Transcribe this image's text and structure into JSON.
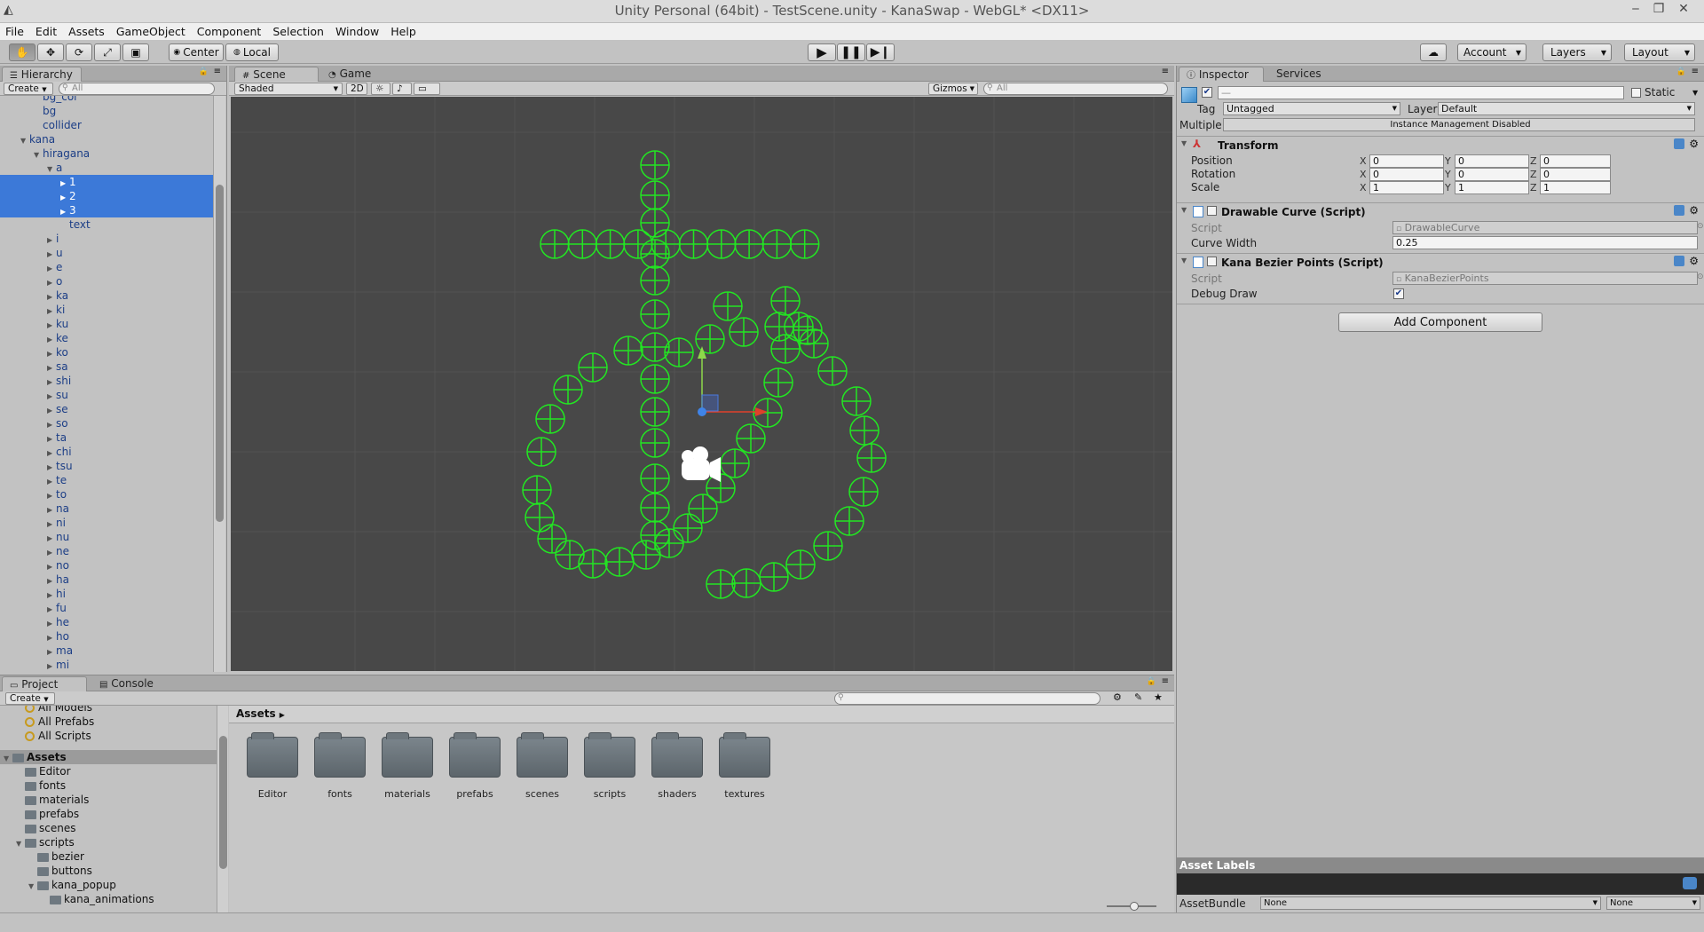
{
  "window": {
    "title": "Unity Personal (64bit) - TestScene.unity - KanaSwap - WebGL* <DX11>"
  },
  "menu": [
    "File",
    "Edit",
    "Assets",
    "GameObject",
    "Component",
    "Selection",
    "Window",
    "Help"
  ],
  "toolbar": {
    "center_label": "Center",
    "local_label": "Local",
    "account_label": "Account",
    "layers_label": "Layers",
    "layout_label": "Layout"
  },
  "hierarchy": {
    "tab_label": "Hierarchy",
    "create_label": "Create",
    "search_placeholder": "All",
    "items": [
      {
        "label": "bg_col",
        "indent": 2,
        "arrow": "",
        "selected": false
      },
      {
        "label": "bg",
        "indent": 2,
        "arrow": "",
        "selected": false
      },
      {
        "label": "collider",
        "indent": 2,
        "arrow": "",
        "selected": false
      },
      {
        "label": "kana",
        "indent": 1,
        "arrow": "open",
        "selected": false
      },
      {
        "label": "hiragana",
        "indent": 2,
        "arrow": "open",
        "selected": false
      },
      {
        "label": "a",
        "indent": 3,
        "arrow": "open",
        "selected": false
      },
      {
        "label": "1",
        "indent": 4,
        "arrow": "closed",
        "selected": true
      },
      {
        "label": "2",
        "indent": 4,
        "arrow": "closed",
        "selected": true
      },
      {
        "label": "3",
        "indent": 4,
        "arrow": "closed",
        "selected": true
      },
      {
        "label": "text",
        "indent": 4,
        "arrow": "",
        "selected": false
      },
      {
        "label": "i",
        "indent": 3,
        "arrow": "closed",
        "selected": false
      },
      {
        "label": "u",
        "indent": 3,
        "arrow": "closed",
        "selected": false
      },
      {
        "label": "e",
        "indent": 3,
        "arrow": "closed",
        "selected": false
      },
      {
        "label": "o",
        "indent": 3,
        "arrow": "closed",
        "selected": false
      },
      {
        "label": "ka",
        "indent": 3,
        "arrow": "closed",
        "selected": false
      },
      {
        "label": "ki",
        "indent": 3,
        "arrow": "closed",
        "selected": false
      },
      {
        "label": "ku",
        "indent": 3,
        "arrow": "closed",
        "selected": false
      },
      {
        "label": "ke",
        "indent": 3,
        "arrow": "closed",
        "selected": false
      },
      {
        "label": "ko",
        "indent": 3,
        "arrow": "closed",
        "selected": false
      },
      {
        "label": "sa",
        "indent": 3,
        "arrow": "closed",
        "selected": false
      },
      {
        "label": "shi",
        "indent": 3,
        "arrow": "closed",
        "selected": false
      },
      {
        "label": "su",
        "indent": 3,
        "arrow": "closed",
        "selected": false
      },
      {
        "label": "se",
        "indent": 3,
        "arrow": "closed",
        "selected": false
      },
      {
        "label": "so",
        "indent": 3,
        "arrow": "closed",
        "selected": false
      },
      {
        "label": "ta",
        "indent": 3,
        "arrow": "closed",
        "selected": false
      },
      {
        "label": "chi",
        "indent": 3,
        "arrow": "closed",
        "selected": false
      },
      {
        "label": "tsu",
        "indent": 3,
        "arrow": "closed",
        "selected": false
      },
      {
        "label": "te",
        "indent": 3,
        "arrow": "closed",
        "selected": false
      },
      {
        "label": "to",
        "indent": 3,
        "arrow": "closed",
        "selected": false
      },
      {
        "label": "na",
        "indent": 3,
        "arrow": "closed",
        "selected": false
      },
      {
        "label": "ni",
        "indent": 3,
        "arrow": "closed",
        "selected": false
      },
      {
        "label": "nu",
        "indent": 3,
        "arrow": "closed",
        "selected": false
      },
      {
        "label": "ne",
        "indent": 3,
        "arrow": "closed",
        "selected": false
      },
      {
        "label": "no",
        "indent": 3,
        "arrow": "closed",
        "selected": false
      },
      {
        "label": "ha",
        "indent": 3,
        "arrow": "closed",
        "selected": false
      },
      {
        "label": "hi",
        "indent": 3,
        "arrow": "closed",
        "selected": false
      },
      {
        "label": "fu",
        "indent": 3,
        "arrow": "closed",
        "selected": false
      },
      {
        "label": "he",
        "indent": 3,
        "arrow": "closed",
        "selected": false
      },
      {
        "label": "ho",
        "indent": 3,
        "arrow": "closed",
        "selected": false
      },
      {
        "label": "ma",
        "indent": 3,
        "arrow": "closed",
        "selected": false
      },
      {
        "label": "mi",
        "indent": 3,
        "arrow": "closed",
        "selected": false
      }
    ]
  },
  "scene": {
    "tab_label": "Scene",
    "game_tab_label": "Game",
    "shading_label": "Shaded",
    "mode_2d_label": "2D",
    "gizmos_label": "Gizmos",
    "search_placeholder": "All"
  },
  "inspector": {
    "tab_label": "Inspector",
    "services_tab_label": "Services",
    "name_value": "—",
    "static_label": "Static",
    "tag_label": "Tag",
    "tag_value": "Untagged",
    "layer_label": "Layer",
    "layer_value": "Default",
    "multiple_label": "Multiple",
    "instance_label": "Instance Management Disabled",
    "transform": {
      "title": "Transform",
      "position_label": "Position",
      "rotation_label": "Rotation",
      "scale_label": "Scale",
      "position": [
        "0",
        "0",
        "0"
      ],
      "rotation": [
        "0",
        "0",
        "0"
      ],
      "scale": [
        "1",
        "1",
        "1"
      ]
    },
    "axis": [
      "X",
      "Y",
      "Z"
    ],
    "drawable": {
      "title": "Drawable Curve (Script)",
      "script_label": "Script",
      "script_value": "DrawableCurve",
      "width_label": "Curve Width",
      "width_value": "0.25"
    },
    "bezier": {
      "title": "Kana Bezier Points (Script)",
      "script_label": "Script",
      "script_value": "KanaBezierPoints",
      "debug_label": "Debug Draw"
    },
    "add_component_label": "Add Component",
    "asset_labels_title": "Asset Labels",
    "assetbundle_label": "AssetBundle",
    "assetbundle_value": "None",
    "variant_value": "None"
  },
  "project": {
    "tab_label": "Project",
    "console_tab_label": "Console",
    "create_label": "Create",
    "favorites": [
      "All Models",
      "All Prefabs",
      "All Scripts"
    ],
    "tree": [
      {
        "label": "Assets",
        "indent": 0,
        "bold": true
      },
      {
        "label": "Editor",
        "indent": 1,
        "bold": false
      },
      {
        "label": "fonts",
        "indent": 1,
        "bold": false
      },
      {
        "label": "materials",
        "indent": 1,
        "bold": false
      },
      {
        "label": "prefabs",
        "indent": 1,
        "bold": false
      },
      {
        "label": "scenes",
        "indent": 1,
        "bold": false
      },
      {
        "label": "scripts",
        "indent": 1,
        "bold": false
      },
      {
        "label": "bezier",
        "indent": 2,
        "bold": false
      },
      {
        "label": "buttons",
        "indent": 2,
        "bold": false
      },
      {
        "label": "kana_popup",
        "indent": 2,
        "bold": false
      },
      {
        "label": "kana_animations",
        "indent": 3,
        "bold": false
      }
    ],
    "breadcrumb": "Assets",
    "folders": [
      "Editor",
      "fonts",
      "materials",
      "prefabs",
      "scenes",
      "scripts",
      "shaders",
      "textures"
    ]
  },
  "colors": {
    "selection": "#3c79d8",
    "gizmo_green": "#22e622",
    "scene_bg": "#484848",
    "hier_text": "#1c3e86"
  }
}
